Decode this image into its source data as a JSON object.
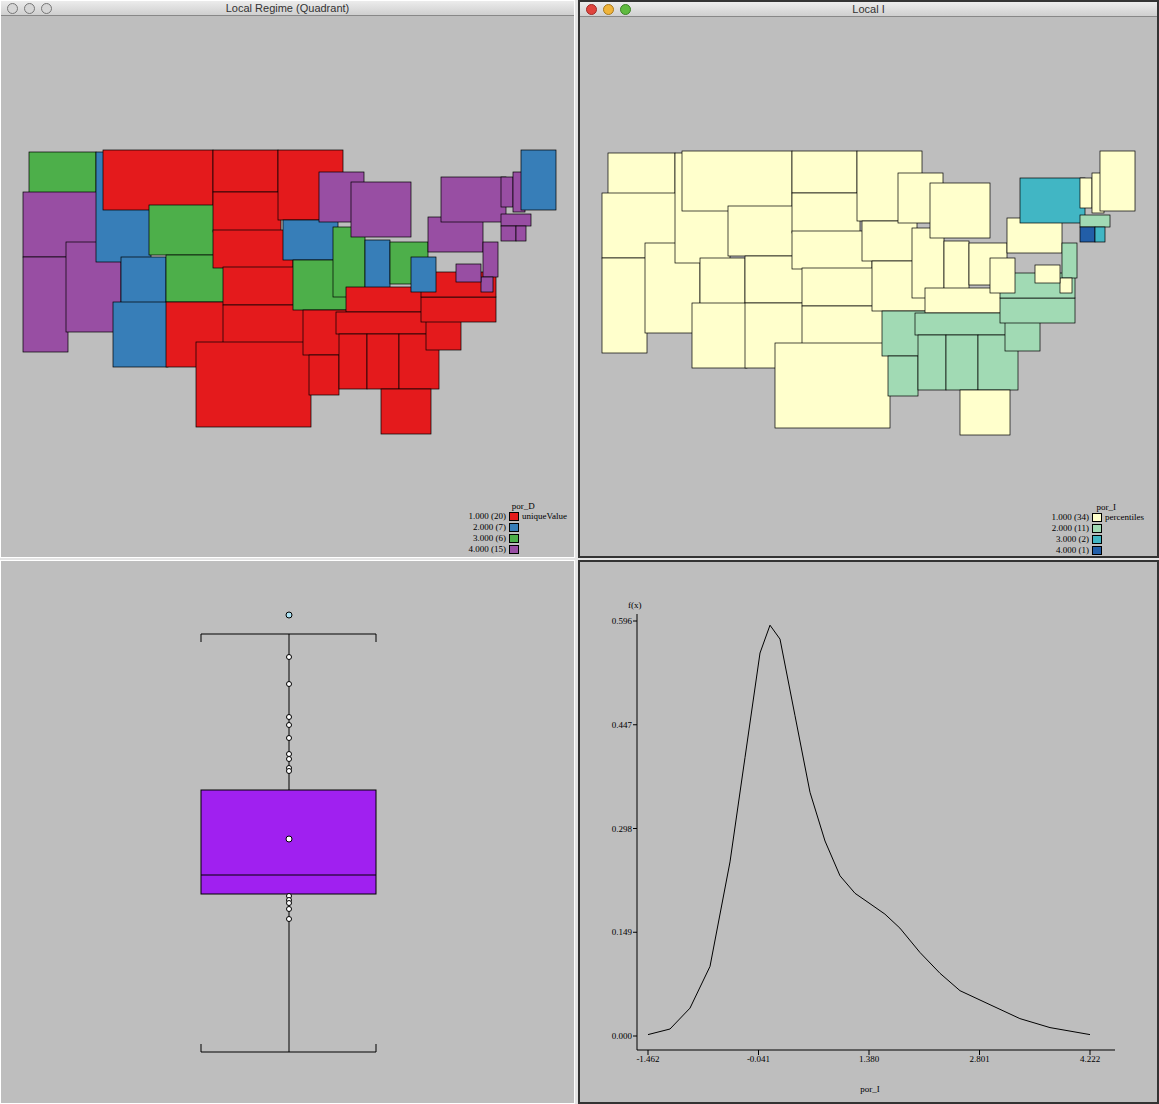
{
  "regime_map": {
    "title": "Local Regime (Quadrant)",
    "active": false,
    "legend": {
      "variable": "por_D",
      "scheme": "uniqueValue",
      "entries": [
        {
          "label": "1.000 (20)",
          "color": "#e41a1c"
        },
        {
          "label": "2.000 (7)",
          "color": "#377eb8"
        },
        {
          "label": "3.000 (6)",
          "color": "#4daf4a"
        },
        {
          "label": "4.000 (15)",
          "color": "#984ea3"
        }
      ]
    },
    "categories": [
      3,
      4,
      4,
      4,
      2,
      1,
      3,
      2,
      2,
      3,
      1,
      1,
      1,
      1,
      1,
      1,
      1,
      1,
      2,
      3,
      1,
      1,
      4,
      3,
      4,
      2,
      3,
      1,
      1,
      1,
      1,
      1,
      1,
      1,
      1,
      1,
      2,
      4,
      4,
      4,
      4,
      2,
      4,
      4,
      4,
      4,
      4,
      4
    ]
  },
  "local_i_map": {
    "title": "Local I",
    "active": true,
    "legend": {
      "variable": "por_I",
      "scheme": "percentiles",
      "entries": [
        {
          "label": "1.000 (34)",
          "color": "#ffffcc"
        },
        {
          "label": "2.000 (11)",
          "color": "#a1dab4"
        },
        {
          "label": "3.000 (2)",
          "color": "#41b6c4"
        },
        {
          "label": "4.000 (1)",
          "color": "#225ea8"
        }
      ]
    },
    "categories": [
      1,
      1,
      1,
      1,
      1,
      1,
      1,
      1,
      1,
      1,
      1,
      1,
      1,
      1,
      1,
      1,
      1,
      1,
      1,
      1,
      2,
      2,
      1,
      1,
      1,
      1,
      1,
      1,
      2,
      2,
      2,
      2,
      1,
      2,
      2,
      2,
      1,
      1,
      3,
      1,
      1,
      1,
      2,
      4,
      3,
      2,
      1,
      1
    ]
  },
  "box_plot": {
    "upper_whisker": 4.03,
    "q3": 2.47,
    "median": 1.62,
    "q1": 1.43,
    "lower_whisker": -0.15,
    "mean": 1.98,
    "points": [
      3.8,
      3.53,
      3.2,
      3.12,
      2.99,
      2.83,
      2.78,
      2.69,
      2.66,
      1.41,
      1.37,
      1.34,
      1.28,
      1.18
    ],
    "outliers": [
      4.22
    ]
  },
  "density": {
    "y_label": "f(x)",
    "x_label": "por_I",
    "x_ticks": [
      "-1.462",
      "-0.041",
      "1.380",
      "2.801",
      "4.222"
    ],
    "y_ticks": [
      "0.000",
      "0.149",
      "0.298",
      "0.447",
      "0.596"
    ],
    "x": [
      -1.462,
      -1.179,
      -0.922,
      -0.665,
      -0.408,
      -0.215,
      -0.022,
      0.107,
      0.235,
      0.428,
      0.621,
      0.814,
      1.007,
      1.2,
      1.393,
      1.585,
      1.778,
      2.035,
      2.293,
      2.55,
      2.936,
      3.321,
      3.707,
      4.222
    ],
    "y": [
      0.002,
      0.01,
      0.04,
      0.1,
      0.25,
      0.4,
      0.55,
      0.59,
      0.57,
      0.46,
      0.35,
      0.28,
      0.23,
      0.205,
      0.19,
      0.175,
      0.155,
      0.12,
      0.09,
      0.065,
      0.045,
      0.025,
      0.012,
      0.002
    ]
  }
}
